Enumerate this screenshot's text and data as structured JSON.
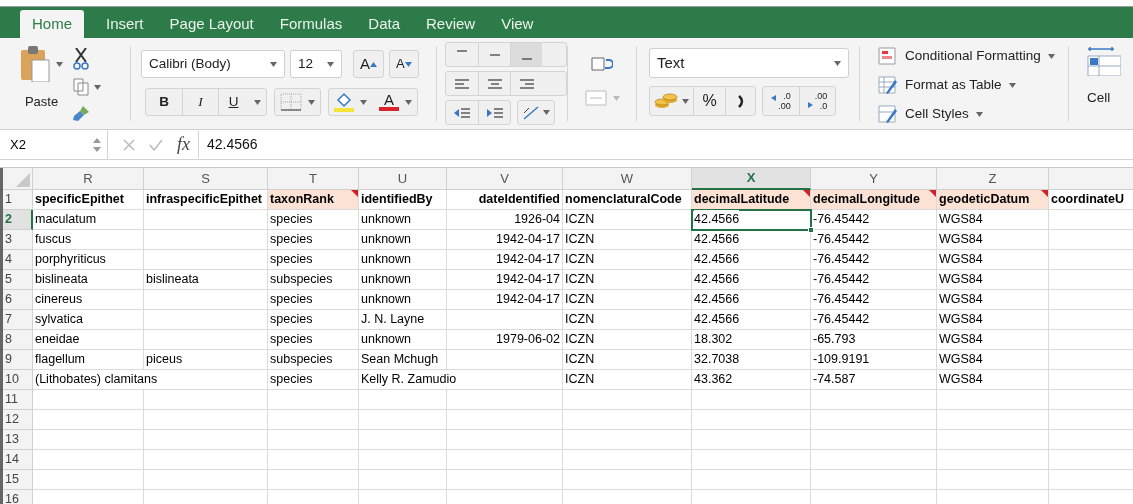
{
  "tabs": [
    {
      "label": "Home",
      "selected": true
    },
    {
      "label": "Insert",
      "selected": false
    },
    {
      "label": "Page Layout",
      "selected": false
    },
    {
      "label": "Formulas",
      "selected": false
    },
    {
      "label": "Data",
      "selected": false
    },
    {
      "label": "Review",
      "selected": false
    },
    {
      "label": "View",
      "selected": false
    }
  ],
  "ribbon": {
    "paste_label": "Paste",
    "font_name": "Calibri (Body)",
    "font_size": "12",
    "grow_font": "A",
    "shrink_font": "A",
    "bold": "B",
    "italic": "I",
    "underline": "U",
    "font_color": "A",
    "number_format": "Text",
    "percent": "%",
    "decimal_increase": [
      ".0",
      ".00"
    ],
    "decimal_decrease": [
      ".00",
      ".0"
    ],
    "styles": [
      "Conditional Formatting",
      "Format as Table",
      "Cell Styles"
    ],
    "cells_label": "Cell"
  },
  "formula_bar": {
    "name_box": "X2",
    "fx": "fx",
    "formula": "42.4566"
  },
  "columns": [
    {
      "letter": "R",
      "kind": "text",
      "selected": false
    },
    {
      "letter": "S",
      "kind": "text",
      "selected": false
    },
    {
      "letter": "T",
      "kind": "text",
      "selected": false
    },
    {
      "letter": "U",
      "kind": "text",
      "selected": false
    },
    {
      "letter": "V",
      "kind": "date",
      "selected": false
    },
    {
      "letter": "W",
      "kind": "text",
      "selected": false
    },
    {
      "letter": "X",
      "kind": "text",
      "selected": true
    },
    {
      "letter": "Y",
      "kind": "text",
      "selected": false
    },
    {
      "letter": "Z",
      "kind": "text",
      "selected": false
    },
    {
      "kind": "text",
      "selected": false
    }
  ],
  "header_row": {
    "number": "1",
    "selected": false,
    "cells": [
      {
        "text": "specificEpithet",
        "highlighted": false,
        "comment": false
      },
      {
        "text": "infraspecificEpithet",
        "highlighted": false,
        "comment": false
      },
      {
        "text": "taxonRank",
        "highlighted": true,
        "comment": true
      },
      {
        "text": "identifiedBy",
        "highlighted": false,
        "comment": false
      },
      {
        "text": "dateIdentified",
        "highlighted": false,
        "comment": false
      },
      {
        "text": "nomenclaturalCode",
        "highlighted": false,
        "comment": false
      },
      {
        "text": "decimalLatitude",
        "highlighted": true,
        "comment": true
      },
      {
        "text": "decimalLongitude",
        "highlighted": true,
        "comment": true
      },
      {
        "text": "geodeticDatum",
        "highlighted": true,
        "comment": true
      },
      {
        "text": "coordinateU",
        "highlighted": false,
        "comment": false
      }
    ]
  },
  "rows": [
    {
      "number": "2",
      "selected": true,
      "cells": [
        "maculatum",
        null,
        "species",
        "unknown",
        "1926-04",
        "ICZN",
        "42.4566",
        "-76.45442",
        "WGS84",
        null
      ]
    },
    {
      "number": "3",
      "selected": false,
      "cells": [
        "fuscus",
        null,
        "species",
        "unknown",
        "1942-04-17",
        "ICZN",
        "42.4566",
        "-76.45442",
        "WGS84",
        null
      ]
    },
    {
      "number": "4",
      "selected": false,
      "cells": [
        "porphyriticus",
        null,
        "species",
        "unknown",
        "1942-04-17",
        "ICZN",
        "42.4566",
        "-76.45442",
        "WGS84",
        null
      ]
    },
    {
      "number": "5",
      "selected": false,
      "cells": [
        "bislineata",
        "bislineata",
        "subspecies",
        "unknown",
        "1942-04-17",
        "ICZN",
        "42.4566",
        "-76.45442",
        "WGS84",
        null
      ]
    },
    {
      "number": "6",
      "selected": false,
      "cells": [
        "cinereus",
        null,
        "species",
        "unknown",
        "1942-04-17",
        "ICZN",
        "42.4566",
        "-76.45442",
        "WGS84",
        null
      ]
    },
    {
      "number": "7",
      "selected": false,
      "cells": [
        "sylvatica",
        null,
        "species",
        "J. N. Layne",
        null,
        "ICZN",
        "42.4566",
        "-76.45442",
        "WGS84",
        null
      ]
    },
    {
      "number": "8",
      "selected": false,
      "cells": [
        "eneidae",
        null,
        "species",
        "unknown",
        "1979-06-02",
        "ICZN",
        "18.302",
        "-65.793",
        "WGS84",
        null
      ]
    },
    {
      "number": "9",
      "selected": false,
      "cells": [
        "flagellum",
        "piceus",
        "subspecies",
        "Sean Mchugh",
        null,
        "ICZN",
        "32.7038",
        "-109.9191",
        "WGS84",
        null
      ]
    },
    {
      "number": "10",
      "selected": false,
      "cells": [
        "(Lithobates) clamitans",
        null,
        "species",
        "Kelly R. Zamudio",
        null,
        "ICZN",
        "43.362",
        "-74.587",
        "WGS84",
        null
      ]
    },
    {
      "number": "11",
      "selected": false
    },
    {
      "number": "12",
      "selected": false
    },
    {
      "number": "13",
      "selected": false
    },
    {
      "number": "14",
      "selected": false
    },
    {
      "number": "15",
      "selected": false
    },
    {
      "number": "16",
      "selected": false
    }
  ]
}
